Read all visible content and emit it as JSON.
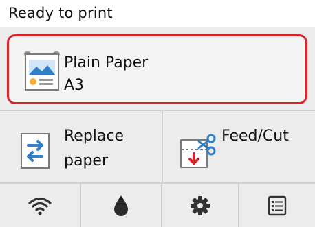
{
  "status": {
    "text": "Ready to print"
  },
  "paper": {
    "type": "Plain Paper",
    "size": "A3",
    "icon": "paper-roll-icon",
    "highlight_color": "#d9232a"
  },
  "actions": [
    {
      "id": "replace",
      "label_line1": "Replace",
      "label_line2": "paper",
      "icon": "replace-paper-icon"
    },
    {
      "id": "feedcut",
      "label_line1": "Feed/Cut",
      "label_line2": "",
      "icon": "feed-cut-icon"
    }
  ],
  "bottom_bar": [
    {
      "id": "wifi",
      "icon": "wifi-icon"
    },
    {
      "id": "ink",
      "icon": "ink-drop-icon"
    },
    {
      "id": "settings",
      "icon": "gear-icon"
    },
    {
      "id": "jobs",
      "icon": "list-icon"
    }
  ],
  "colors": {
    "panel_background": "#ececec",
    "accent_blue": "#2f7fc9",
    "accent_red": "#d9232a"
  }
}
